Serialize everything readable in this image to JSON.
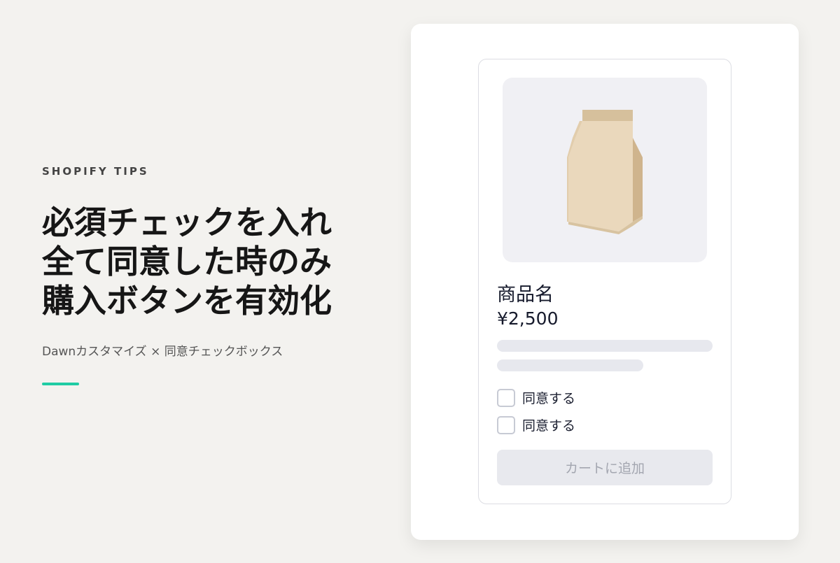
{
  "left": {
    "eyebrow": "SHOPIFY TIPS",
    "headline_lines": [
      "必須チェックを入れ",
      "全て同意した時のみ",
      "購入ボタンを有効化"
    ],
    "subtitle": "Dawnカスタマイズ × 同意チェックボックス",
    "accent_color": "#1fcca4"
  },
  "product_card": {
    "image_icon": "coffee-bag-icon",
    "name": "商品名",
    "price": "¥2,500",
    "checkboxes": [
      {
        "label": "同意する",
        "checked": false
      },
      {
        "label": "同意する",
        "checked": false
      }
    ],
    "add_to_cart_label": "カートに追加",
    "add_to_cart_disabled": true
  }
}
